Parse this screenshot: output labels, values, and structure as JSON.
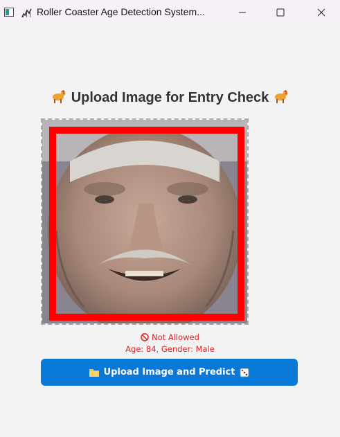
{
  "window": {
    "title": "Roller Coaster Age Detection System...",
    "title_icon": "roller-coaster-emoji",
    "controls": [
      "minimize-icon",
      "maximize-icon",
      "close-icon"
    ]
  },
  "main": {
    "heading": "Upload Image for Entry Check",
    "heading_icon": "carousel-horse-emoji",
    "image": {
      "description_icon": "uploaded-face-photo",
      "detection_box_color": "#ff0000"
    },
    "result": {
      "status": "Not Allowed",
      "status_icon": "prohibited-icon",
      "details": "Age: 84, Gender: Male",
      "color": "#e02020"
    },
    "upload_button": {
      "label": "Upload Image and Predict",
      "leading_icon": "folder-icon",
      "trailing_icon": "dice-icon",
      "color": "#0a78d7"
    }
  }
}
